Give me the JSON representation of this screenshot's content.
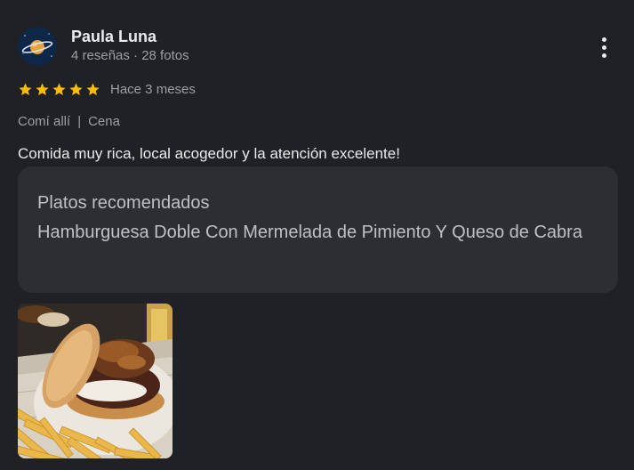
{
  "review": {
    "author": {
      "name": "Paula Luna",
      "stats": "4 reseñas · 28 fotos",
      "avatar_icon": "planet-avatar-icon"
    },
    "rating": 5,
    "time_ago": "Hace 3 meses",
    "tags": {
      "visit": "Comí allí",
      "meal": "Cena"
    },
    "text": "Comida muy rica, local acogedor y la atención excelente!",
    "recommended": {
      "title": "Platos recomendados",
      "dishes": "Hamburguesa Doble Con Mermelada de Pimiento Y Queso de Cabra"
    },
    "photo_icon": "burger-photo"
  },
  "colors": {
    "background": "#202124",
    "star": "#fbbc04",
    "secondary_text": "#9aa0a6",
    "card": "#2d2e31"
  }
}
